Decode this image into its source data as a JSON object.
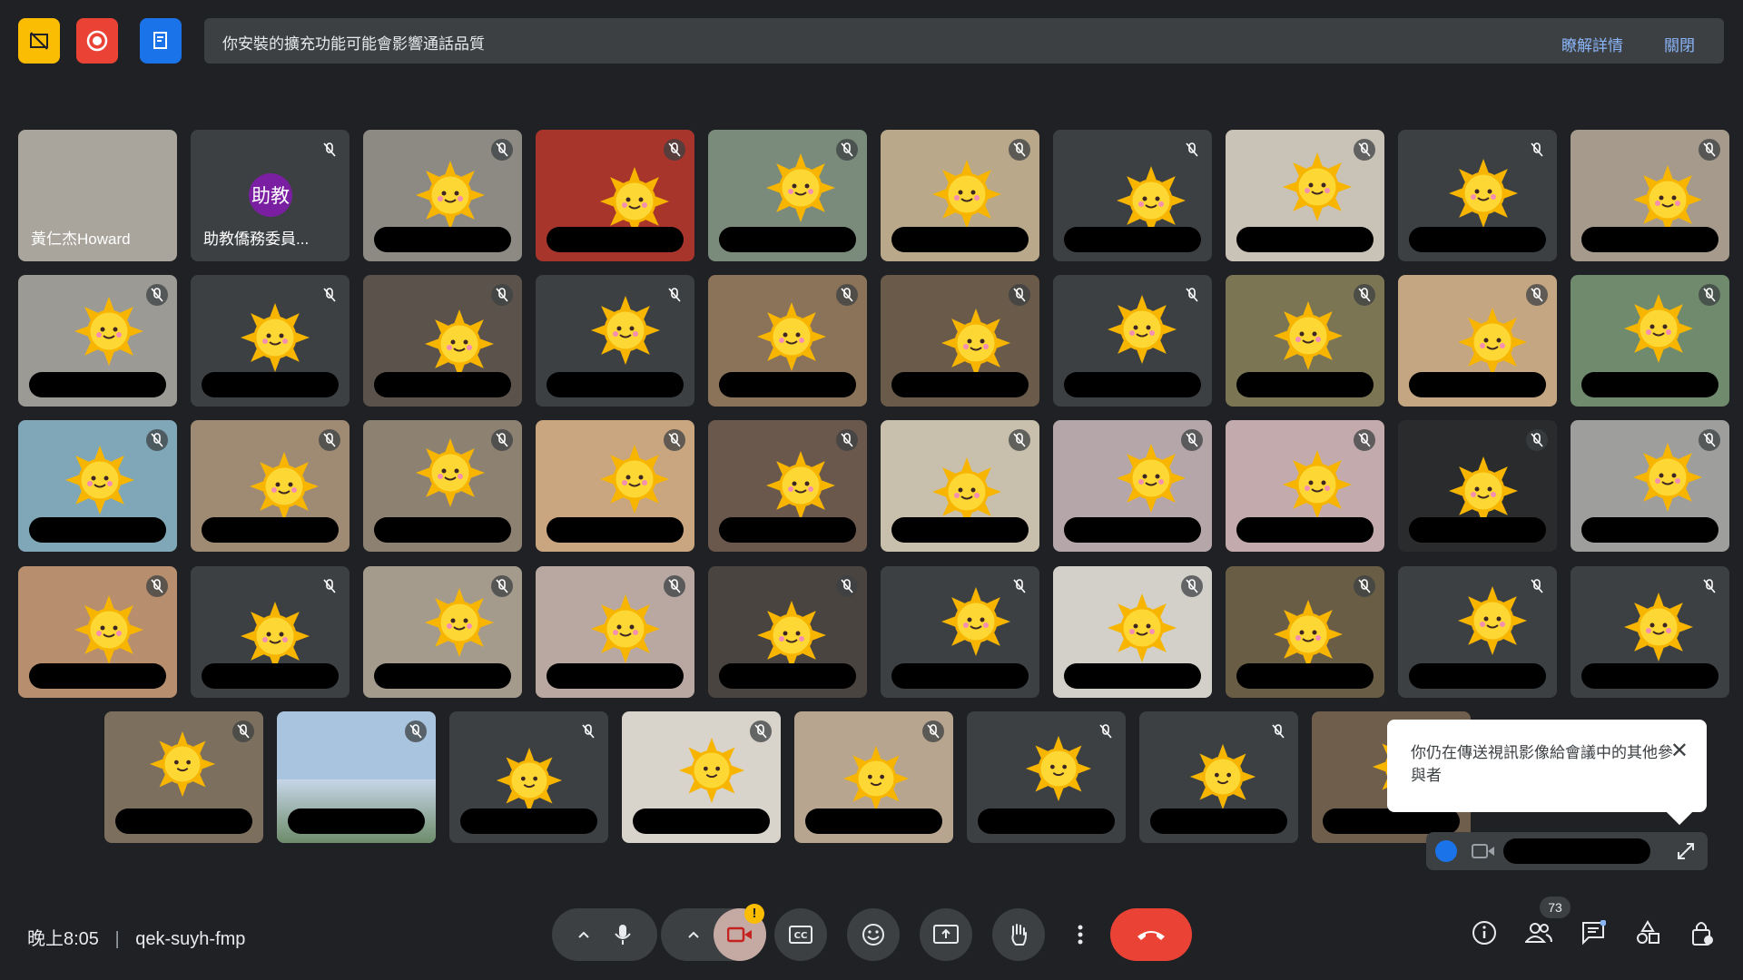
{
  "banner": {
    "message": "你安裝的擴充功能可能會影響通話品質",
    "learn_more": "瞭解詳情",
    "close": "關閉"
  },
  "toolbar_top": {
    "icons": [
      "self-view-off-icon",
      "record-icon",
      "notes-icon"
    ],
    "colors": {
      "yellow": "#fbbc04",
      "red": "#ea4335",
      "blue": "#1a73e8"
    }
  },
  "participants": {
    "host_name": "黃仁杰Howard",
    "assistant_name": "助教僑務委員...",
    "assistant_avatar": "助教"
  },
  "toast": {
    "text": "你仍在傳送視訊影像給會議中的其他參與者"
  },
  "meeting": {
    "time": "晚上8:05",
    "separator": "|",
    "code": "qek-suyh-fmp"
  },
  "people_count": "73",
  "controls": [
    "chevron-up-icon",
    "microphone-icon",
    "chevron-up-icon",
    "camera-icon",
    "captions-icon",
    "emoji-icon",
    "present-icon",
    "raise-hand-icon",
    "more-options-icon",
    "end-call-icon"
  ],
  "right_controls": [
    "info-icon",
    "people-icon",
    "chat-icon",
    "activities-icon",
    "host-controls-icon"
  ]
}
